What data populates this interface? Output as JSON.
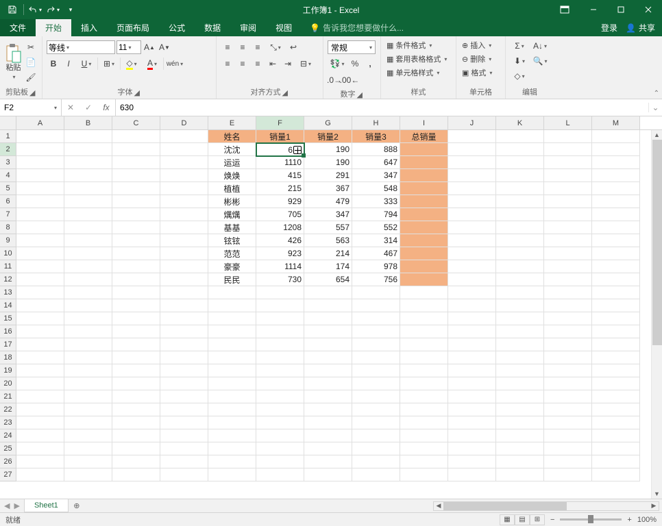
{
  "title": "工作簿1 - Excel",
  "tabs": {
    "file": "文件",
    "home": "开始",
    "insert": "插入",
    "layout": "页面布局",
    "formulas": "公式",
    "data": "数据",
    "review": "审阅",
    "view": "视图"
  },
  "tellme": "告诉我您想要做什么...",
  "login": "登录",
  "share": "共享",
  "ribbon": {
    "clipboard": {
      "paste": "粘贴",
      "label": "剪贴板"
    },
    "font": {
      "name": "等线",
      "size": "11",
      "label": "字体"
    },
    "align": {
      "label": "对齐方式"
    },
    "number": {
      "format": "常规",
      "label": "数字"
    },
    "styles": {
      "cond": "条件格式",
      "table": "套用表格格式",
      "cell": "单元格样式",
      "label": "样式"
    },
    "cells": {
      "insert": "插入",
      "delete": "删除",
      "format": "格式",
      "label": "单元格"
    },
    "editing": {
      "label": "编辑"
    }
  },
  "namebox": "F2",
  "formula": "630",
  "cols": [
    "A",
    "B",
    "C",
    "D",
    "E",
    "F",
    "G",
    "H",
    "I",
    "J",
    "K",
    "L",
    "M"
  ],
  "activeCol": 5,
  "activeRow": 1,
  "headersRow": [
    "姓名",
    "销量1",
    "销量2",
    "销量3",
    "总销量"
  ],
  "dataRows": [
    {
      "name": "沈沈",
      "s1": "630",
      "s2": "190",
      "s3": "888"
    },
    {
      "name": "运运",
      "s1": "1110",
      "s2": "190",
      "s3": "647"
    },
    {
      "name": "焕焕",
      "s1": "415",
      "s2": "291",
      "s3": "347"
    },
    {
      "name": "植植",
      "s1": "215",
      "s2": "367",
      "s3": "548"
    },
    {
      "name": "彬彬",
      "s1": "929",
      "s2": "479",
      "s3": "333"
    },
    {
      "name": "燤燤",
      "s1": "705",
      "s2": "347",
      "s3": "794"
    },
    {
      "name": "基基",
      "s1": "1208",
      "s2": "557",
      "s3": "552"
    },
    {
      "name": "铉铉",
      "s1": "426",
      "s2": "563",
      "s3": "314"
    },
    {
      "name": "范范",
      "s1": "923",
      "s2": "214",
      "s3": "467"
    },
    {
      "name": "豪豪",
      "s1": "1114",
      "s2": "174",
      "s3": "978"
    },
    {
      "name": "民民",
      "s1": "730",
      "s2": "654",
      "s3": "756"
    }
  ],
  "selectedDisplay": "6",
  "sheet": "Sheet1",
  "status": "就绪",
  "zoom": "100%"
}
